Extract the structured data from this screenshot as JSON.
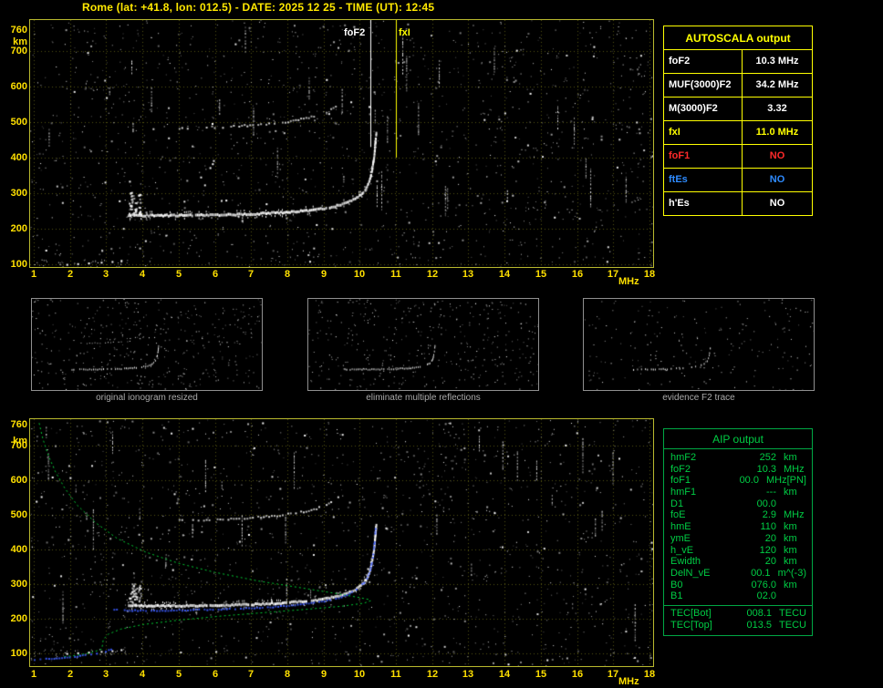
{
  "title": "Rome (lat: +41.8, lon: 012.5) - DATE: 2025 12 25 - TIME (UT): 12:45",
  "axes": {
    "x_ticks": [
      "1",
      "2",
      "3",
      "4",
      "5",
      "6",
      "7",
      "8",
      "9",
      "10",
      "11",
      "12",
      "13",
      "14",
      "15",
      "16",
      "17",
      "18"
    ],
    "x_unit": "MHz",
    "y_ticks": [
      "760",
      "700",
      "600",
      "500",
      "400",
      "300",
      "200",
      "100"
    ],
    "y_unit": "km"
  },
  "top_plot": {
    "foF2_label": "foF2",
    "fxI_label": "fxI"
  },
  "thumbnails": [
    {
      "caption": "original ionogram resized"
    },
    {
      "caption": "eliminate multiple reflections"
    },
    {
      "caption": "evidence F2 trace"
    }
  ],
  "autoscala": {
    "header": "AUTOSCALA output",
    "rows": [
      {
        "label": "foF2",
        "value": "10.3 MHz",
        "color": "#ffffff"
      },
      {
        "label": "MUF(3000)F2",
        "value": "34.2 MHz",
        "color": "#ffffff"
      },
      {
        "label": "M(3000)F2",
        "value": "3.32",
        "color": "#ffffff"
      },
      {
        "label": "fxI",
        "value": "11.0 MHz",
        "color": "#ffff00"
      },
      {
        "label": "foF1",
        "value": "NO",
        "color": "#ff2a2a"
      },
      {
        "label": "ftEs",
        "value": "NO",
        "color": "#2e8bff"
      },
      {
        "label": "h'Es",
        "value": "NO",
        "color": "#ffffff"
      }
    ]
  },
  "aip": {
    "header": "AIP output",
    "rows": [
      {
        "name": "hmF2",
        "value": "252",
        "unit": "km",
        "note": ""
      },
      {
        "name": "foF2",
        "value": "10.3",
        "unit": "MHz",
        "note": ""
      },
      {
        "name": "foF1",
        "value": "00.0",
        "unit": "MHz",
        "note": "[PN]"
      },
      {
        "name": "hmF1",
        "value": "---",
        "unit": "km",
        "note": ""
      },
      {
        "name": "D1",
        "value": "00.0",
        "unit": "",
        "note": ""
      },
      {
        "name": "foE",
        "value": "2.9",
        "unit": "MHz",
        "note": ""
      },
      {
        "name": "hmE",
        "value": "110",
        "unit": "km",
        "note": ""
      },
      {
        "name": "ymE",
        "value": "20",
        "unit": "km",
        "note": ""
      },
      {
        "name": "h_vE",
        "value": "120",
        "unit": "km",
        "note": ""
      },
      {
        "name": "Ewidth",
        "value": "20",
        "unit": "km",
        "note": ""
      },
      {
        "name": "DelN_vE",
        "value": "00.1",
        "unit": "m^(-3)",
        "note": ""
      },
      {
        "name": "B0",
        "value": "076.0",
        "unit": "km",
        "note": ""
      },
      {
        "name": "B1",
        "value": "02.0",
        "unit": "",
        "note": ""
      }
    ],
    "tec_rows": [
      {
        "name": "TEC[Bot]",
        "value": "008.1",
        "unit": "TECU",
        "note": ""
      },
      {
        "name": "TEC[Top]",
        "value": "013.5",
        "unit": "TECU",
        "note": ""
      }
    ]
  },
  "chart_data": {
    "type": "scatter",
    "title": "Ionogram: virtual height vs frequency",
    "xlabel": "MHz",
    "ylabel": "km",
    "xlim": [
      1,
      18
    ],
    "ylim": [
      90,
      790
    ],
    "foF2_MHz": 10.3,
    "fxI_MHz": 11.0,
    "f2_trace": [
      [
        3.6,
        242
      ],
      [
        4.0,
        241
      ],
      [
        4.6,
        241
      ],
      [
        5.2,
        241
      ],
      [
        5.8,
        242
      ],
      [
        6.4,
        243
      ],
      [
        7.0,
        245
      ],
      [
        7.6,
        248
      ],
      [
        8.1,
        251
      ],
      [
        8.6,
        255
      ],
      [
        9.0,
        261
      ],
      [
        9.3,
        267
      ],
      [
        9.6,
        276
      ],
      [
        9.85,
        288
      ],
      [
        10.05,
        303
      ],
      [
        10.18,
        322
      ],
      [
        10.27,
        346
      ],
      [
        10.33,
        375
      ],
      [
        10.38,
        410
      ],
      [
        10.41,
        445
      ],
      [
        10.44,
        478
      ]
    ],
    "second_hop_trace": [
      [
        5.0,
        486
      ],
      [
        5.6,
        487
      ],
      [
        6.2,
        489
      ],
      [
        6.8,
        492
      ],
      [
        7.4,
        497
      ],
      [
        8.0,
        504
      ],
      [
        8.5,
        513
      ],
      [
        9.0,
        527
      ],
      [
        9.25,
        541
      ],
      [
        9.45,
        558
      ]
    ],
    "e_region_dots": [
      [
        1.9,
        101
      ],
      [
        2.2,
        103
      ],
      [
        2.5,
        105
      ],
      [
        2.85,
        107
      ],
      [
        3.15,
        109
      ],
      [
        3.4,
        112
      ]
    ],
    "start_cluster": {
      "f_range": [
        3.62,
        3.95
      ],
      "h_range": [
        240,
        305
      ],
      "count": 45
    },
    "profile_curve": [
      [
        1.15,
        765
      ],
      [
        1.25,
        720
      ],
      [
        1.4,
        672
      ],
      [
        1.6,
        624
      ],
      [
        1.85,
        578
      ],
      [
        2.2,
        528
      ],
      [
        2.7,
        478
      ],
      [
        3.3,
        432
      ],
      [
        4.1,
        392
      ],
      [
        5.0,
        360
      ],
      [
        6.0,
        334
      ],
      [
        7.2,
        309
      ],
      [
        8.4,
        289
      ],
      [
        9.4,
        272
      ],
      [
        10.0,
        261
      ],
      [
        10.28,
        255
      ],
      [
        10.3,
        252
      ],
      [
        10.12,
        245
      ],
      [
        9.5,
        236
      ],
      [
        8.5,
        227
      ],
      [
        7.4,
        218
      ],
      [
        6.2,
        208
      ],
      [
        5.0,
        196
      ],
      [
        4.0,
        183
      ],
      [
        3.4,
        170
      ],
      [
        3.05,
        155
      ],
      [
        2.92,
        140
      ],
      [
        2.9,
        126
      ],
      [
        2.88,
        112
      ],
      [
        2.55,
        101
      ],
      [
        2.15,
        94
      ],
      [
        1.8,
        90
      ]
    ],
    "fitted_trace_blue": [
      [
        3.2,
        228
      ],
      [
        3.7,
        226
      ],
      [
        4.3,
        226
      ],
      [
        5.0,
        227
      ],
      [
        6.0,
        229
      ],
      [
        7.0,
        233
      ],
      [
        7.8,
        238
      ],
      [
        8.5,
        245
      ],
      [
        9.0,
        253
      ],
      [
        9.4,
        263
      ],
      [
        9.7,
        275
      ],
      [
        9.95,
        291
      ],
      [
        10.15,
        313
      ],
      [
        10.27,
        342
      ],
      [
        10.34,
        380
      ],
      [
        10.39,
        425
      ],
      [
        10.42,
        470
      ]
    ],
    "blue_bottom_trace": [
      [
        1.0,
        84
      ],
      [
        1.4,
        87
      ],
      [
        1.9,
        91
      ],
      [
        2.4,
        97
      ],
      [
        2.8,
        104
      ],
      [
        3.05,
        111
      ],
      [
        3.18,
        119
      ]
    ],
    "noise": {
      "seed": 20251225,
      "points_main": 1500,
      "streaks": 30,
      "points_thumb": [
        430,
        400,
        210
      ]
    }
  }
}
